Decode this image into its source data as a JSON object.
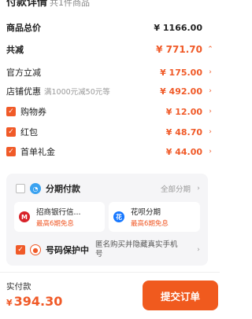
{
  "header": {
    "title": "付款详情",
    "subtitle": "共1件商品"
  },
  "summary": {
    "total_label": "商品总价",
    "total_value": "¥ 1166.00",
    "discount_label": "共减",
    "discount_value": "¥ 771.70"
  },
  "discounts": [
    {
      "label": "官方立减",
      "value": "¥ 175.00",
      "promo": ""
    },
    {
      "label": "店铺优惠",
      "value": "¥ 492.00",
      "promo": "满1000元减50元等"
    },
    {
      "label": "购物券",
      "value": "¥ 12.00",
      "checked": true
    },
    {
      "label": "红包",
      "value": "¥ 48.70",
      "checked": true
    },
    {
      "label": "首单礼金",
      "value": "¥ 44.00",
      "checked": true
    }
  ],
  "installment": {
    "label": "分期付款",
    "all_label": "全部分期",
    "options": [
      {
        "name": "招商银行信...",
        "fee": "最高6期免息",
        "color": "#d8232a"
      },
      {
        "name": "花呗分期",
        "fee": "最高6期免息",
        "color": "#1677ff"
      }
    ]
  },
  "privacy": {
    "label": "号码保护中",
    "desc": "匿名购买并隐藏真实手机号"
  },
  "footer": {
    "pay_label": "实付款",
    "currency": "¥",
    "amount": "394.30",
    "submit_label": "提交订单"
  },
  "colors": {
    "accent": "#f05a28"
  }
}
